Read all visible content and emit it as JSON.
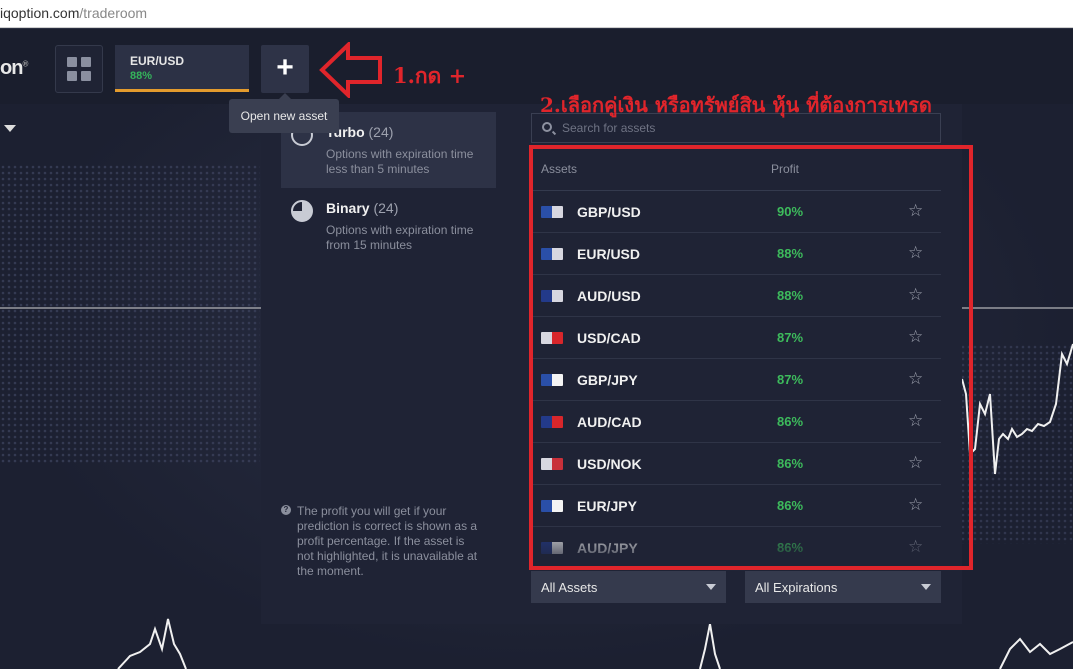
{
  "browser": {
    "url_host": "iqoption.com",
    "url_path": "/traderoom"
  },
  "app": {
    "logo_text": "on",
    "logo_mark": "®"
  },
  "header": {
    "asset_tab": {
      "name": "EUR/USD",
      "profit": "88%"
    },
    "plus_label": "+",
    "tooltip": "Open new asset"
  },
  "categories": [
    {
      "name": "Turbo",
      "count": "(24)",
      "desc": "Options with expiration time less than 5 minutes"
    },
    {
      "name": "Binary",
      "count": "(24)",
      "desc": "Options with expiration time from 15 minutes"
    }
  ],
  "search": {
    "placeholder": "Search for assets"
  },
  "list": {
    "col_assets": "Assets",
    "col_profit": "Profit",
    "rows": [
      {
        "symbol": "GBP/USD",
        "profit": "90%",
        "flag_a": "#2a4fa8",
        "flag_b": "#d7d7e0"
      },
      {
        "symbol": "EUR/USD",
        "profit": "88%",
        "flag_a": "#2a4fa8",
        "flag_b": "#d7d7e0"
      },
      {
        "symbol": "AUD/USD",
        "profit": "88%",
        "flag_a": "#233a8a",
        "flag_b": "#d7d7e0"
      },
      {
        "symbol": "USD/CAD",
        "profit": "87%",
        "flag_a": "#d7d7e0",
        "flag_b": "#d8262b"
      },
      {
        "symbol": "GBP/JPY",
        "profit": "87%",
        "flag_a": "#2a4fa8",
        "flag_b": "#f4f4f4"
      },
      {
        "symbol": "AUD/CAD",
        "profit": "86%",
        "flag_a": "#233a8a",
        "flag_b": "#d8262b"
      },
      {
        "symbol": "USD/NOK",
        "profit": "86%",
        "flag_a": "#d7d7e0",
        "flag_b": "#c8303a"
      },
      {
        "symbol": "EUR/JPY",
        "profit": "86%",
        "flag_a": "#2a4fa8",
        "flag_b": "#f4f4f4"
      },
      {
        "symbol": "AUD/JPY",
        "profit": "86%",
        "flag_a": "#233a8a",
        "flag_b": "#f4f4f4"
      }
    ]
  },
  "note": "The profit you will get if your prediction is correct is shown as a profit percentage. If the asset is not highlighted, it is unavailable at the moment.",
  "filters": {
    "assets": "All Assets",
    "expirations": "All Expirations"
  },
  "annotations": {
    "step1": "1.กด +",
    "step2": "2.เลือกคู่เงิน หรือทรัพย์สิน หุ้น ที่ต้องการเทรด"
  },
  "icons": [
    "grid-icon",
    "plus-icon",
    "turbo-clock-icon",
    "binary-clock-icon",
    "search-icon",
    "star-icon",
    "chevron-down-icon",
    "question-icon"
  ]
}
